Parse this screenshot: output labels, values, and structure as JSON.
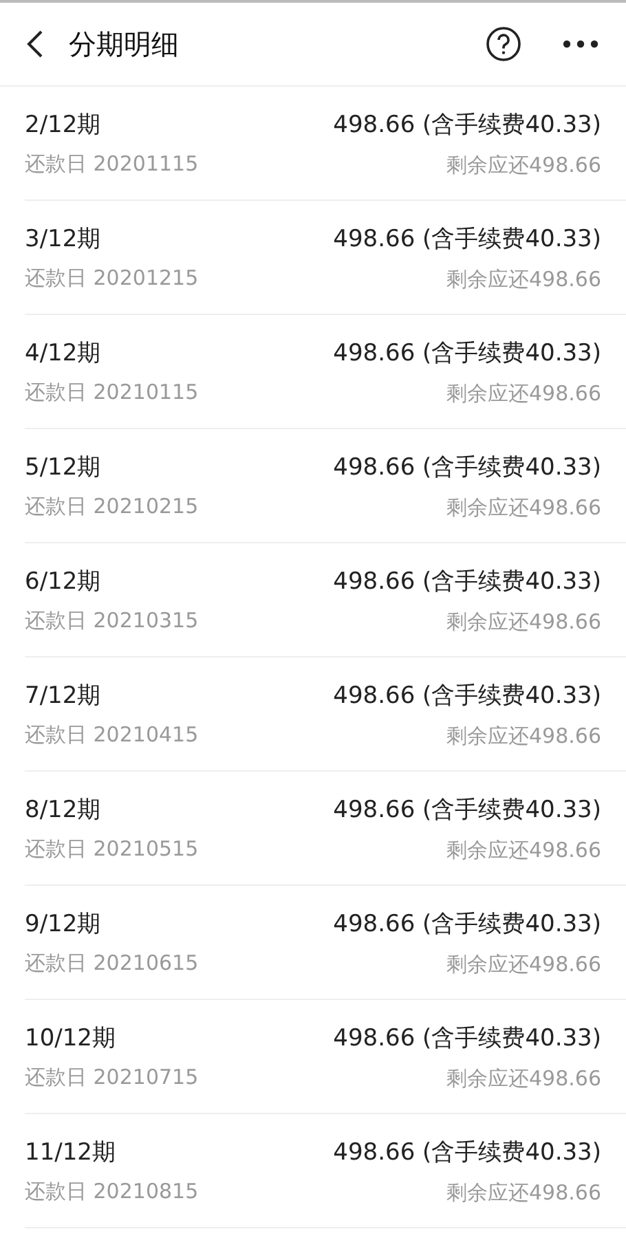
{
  "header": {
    "title": "分期明细"
  },
  "rows": [
    {
      "period": "2/12期",
      "due_date": "还款日 20201115",
      "amount": "498.66 (含手续费40.33)",
      "remaining": "剩余应还498.66"
    },
    {
      "period": "3/12期",
      "due_date": "还款日 20201215",
      "amount": "498.66 (含手续费40.33)",
      "remaining": "剩余应还498.66"
    },
    {
      "period": "4/12期",
      "due_date": "还款日 20210115",
      "amount": "498.66 (含手续费40.33)",
      "remaining": "剩余应还498.66"
    },
    {
      "period": "5/12期",
      "due_date": "还款日 20210215",
      "amount": "498.66 (含手续费40.33)",
      "remaining": "剩余应还498.66"
    },
    {
      "period": "6/12期",
      "due_date": "还款日 20210315",
      "amount": "498.66 (含手续费40.33)",
      "remaining": "剩余应还498.66"
    },
    {
      "period": "7/12期",
      "due_date": "还款日 20210415",
      "amount": "498.66 (含手续费40.33)",
      "remaining": "剩余应还498.66"
    },
    {
      "period": "8/12期",
      "due_date": "还款日 20210515",
      "amount": "498.66 (含手续费40.33)",
      "remaining": "剩余应还498.66"
    },
    {
      "period": "9/12期",
      "due_date": "还款日 20210615",
      "amount": "498.66 (含手续费40.33)",
      "remaining": "剩余应还498.66"
    },
    {
      "period": "10/12期",
      "due_date": "还款日 20210715",
      "amount": "498.66 (含手续费40.33)",
      "remaining": "剩余应还498.66"
    },
    {
      "period": "11/12期",
      "due_date": "还款日 20210815",
      "amount": "498.66 (含手续费40.33)",
      "remaining": "剩余应还498.66"
    }
  ]
}
